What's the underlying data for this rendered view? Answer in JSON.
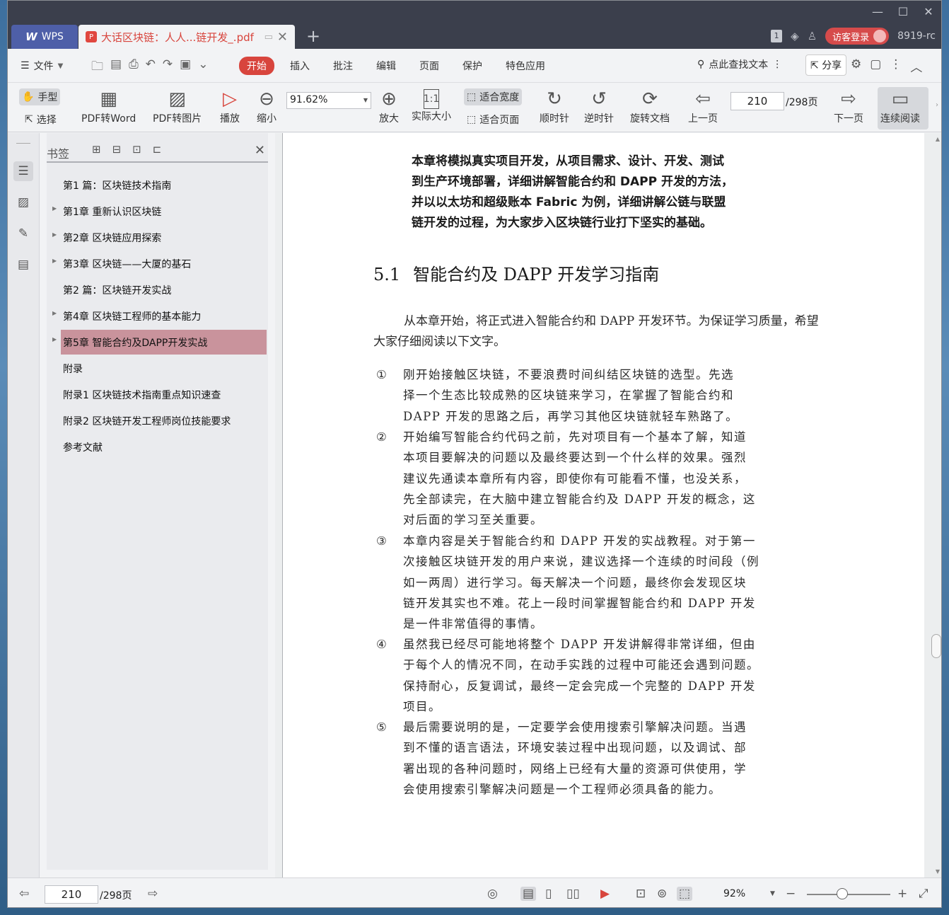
{
  "titlebar": {
    "wps_label": "WPS",
    "doc_tab": "大话区块链：人人...链开发_.pdf",
    "badge_count": "1",
    "login_label": "访客登录",
    "version": "8919-rc"
  },
  "menubar": {
    "file": "文件",
    "items": [
      "开始",
      "插入",
      "批注",
      "编辑",
      "页面",
      "保护",
      "特色应用"
    ],
    "search": "点此查找文本",
    "share": "分享"
  },
  "toolbar": {
    "hand": "手型",
    "select": "选择",
    "pdf_to_word": "PDF转Word",
    "pdf_to_image": "PDF转图片",
    "play": "播放",
    "zoom_out": "缩小",
    "zoom_value": "91.62%",
    "zoom_in": "放大",
    "actual_size": "实际大小",
    "fit_width": "适合宽度",
    "fit_page": "适合页面",
    "clockwise": "顺时针",
    "counterclockwise": "逆时针",
    "rotate_doc": "旋转文档",
    "prev_page": "上一页",
    "current_page": "210",
    "total_pages": "/298页",
    "next_page": "下一页",
    "continuous": "连续阅读"
  },
  "bookmarks": {
    "title": "书签",
    "items": [
      {
        "label": "第1 篇：区块链技术指南",
        "expandable": false
      },
      {
        "label": "第1章 重新认识区块链",
        "expandable": true
      },
      {
        "label": "第2章 区块链应用探索",
        "expandable": true
      },
      {
        "label": "第3章 区块链——大厦的基石",
        "expandable": true
      },
      {
        "label": "第2 篇：区块链开发实战",
        "expandable": false
      },
      {
        "label": "第4章 区块链工程师的基本能力",
        "expandable": true
      },
      {
        "label": "第5章 智能合约及DAPP开发实战",
        "expandable": true
      },
      {
        "label": "附录",
        "expandable": false
      },
      {
        "label": "附录1 区块链技术指南重点知识速查",
        "expandable": false
      },
      {
        "label": "附录2 区块链开发工程师岗位技能要求",
        "expandable": false
      },
      {
        "label": "参考文献",
        "expandable": false
      }
    ]
  },
  "page": {
    "intro_lines": [
      "本章将模拟真实项目开发，从项目需求、设计、开发、测试",
      "到生产环境部署，详细讲解智能合约和 DAPP 开发的方法，",
      "并以以太坊和超级账本 Fabric 为例，详细讲解公链与联盟",
      "链开发的过程，为大家步入区块链行业打下坚实的基础。"
    ],
    "section_number": "5.1",
    "section_title": "智能合约及 DAPP 开发学习指南",
    "paragraph": "从本章开始，将正式进入智能合约和 DAPP 开发环节。为保证学习质量，希望大家仔细阅读以下文字。",
    "list": [
      {
        "mark": "①",
        "lines": [
          "刚开始接触区块链，不要浪费时间纠结区块链的选型。先选",
          "择一个生态比较成熟的区块链来学习，在掌握了智能合约和",
          "DAPP 开发的思路之后，再学习其他区块链就轻车熟路了。"
        ]
      },
      {
        "mark": "②",
        "lines": [
          "开始编写智能合约代码之前，先对项目有一个基本了解，知道",
          "本项目要解决的问题以及最终要达到一个什么样的效果。强烈",
          "建议先通读本章所有内容，即使你有可能看不懂，也没关系，",
          "先全部读完，在大脑中建立智能合约及 DAPP 开发的概念，这",
          "对后面的学习至关重要。"
        ]
      },
      {
        "mark": "③",
        "lines": [
          "本章内容是关于智能合约和 DAPP 开发的实战教程。对于第一",
          "次接触区块链开发的用户来说，建议选择一个连续的时间段（例",
          "如一两周）进行学习。每天解决一个问题，最终你会发现区块",
          "链开发其实也不难。花上一段时间掌握智能合约和 DAPP 开发",
          "是一件非常值得的事情。"
        ]
      },
      {
        "mark": "④",
        "lines": [
          "虽然我已经尽可能地将整个 DAPP 开发讲解得非常详细，但由",
          "于每个人的情况不同，在动手实践的过程中可能还会遇到问题。",
          "保持耐心，反复调试，最终一定会完成一个完整的 DAPP 开发",
          "项目。"
        ]
      },
      {
        "mark": "⑤",
        "lines": [
          "最后需要说明的是，一定要学会使用搜索引擎解决问题。当遇",
          "到不懂的语言语法，环境安装过程中出现问题，以及调试、部",
          "署出现的各种问题时，网络上已经有大量的资源可供使用，学",
          "会使用搜索引擎解决问题是一个工程师必须具备的能力。"
        ]
      }
    ]
  },
  "statusbar": {
    "current_page": "210",
    "total_pages": "/298页",
    "zoom": "92%"
  }
}
